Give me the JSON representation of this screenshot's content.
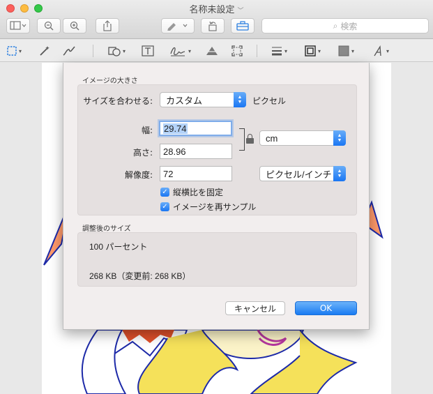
{
  "window": {
    "title": "名称未設定"
  },
  "toolbar": {
    "search_placeholder": "検索"
  },
  "dialog": {
    "image_size_section": "イメージの大きさ",
    "fit_label": "サイズを合わせる:",
    "fit_value": "カスタム",
    "fit_suffix": "ピクセル",
    "width_label": "幅:",
    "width_value": "29.74",
    "height_label": "高さ:",
    "height_value": "28.96",
    "unit_value": "cm",
    "resolution_label": "解像度:",
    "resolution_value": "72",
    "resolution_unit": "ピクセル/インチ",
    "keep_ratio_label": "縦横比を固定",
    "resample_label": "イメージを再サンプル",
    "result_section": "調整後のサイズ",
    "result_percent": "100 パーセント",
    "result_size": "268 KB（変更前: 268 KB）",
    "cancel_label": "キャンセル",
    "ok_label": "OK"
  },
  "colors": {
    "accent": "#1a7bf2",
    "dialog_bg": "#f2eeee"
  }
}
